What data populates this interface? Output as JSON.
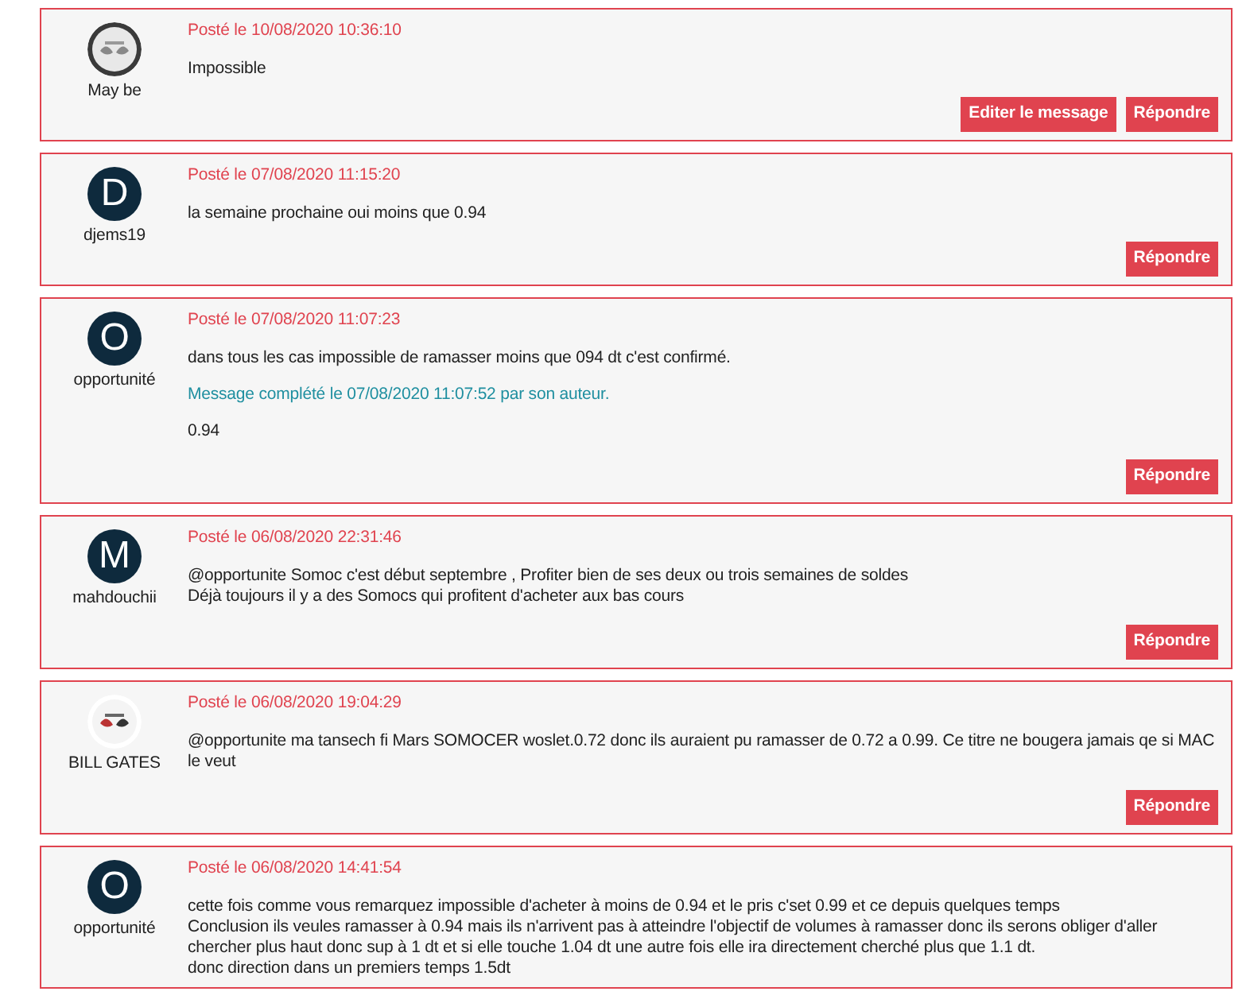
{
  "posts": [
    {
      "author": "May be",
      "avatar": {
        "kind": "picture"
      },
      "date": "Posté le 10/08/2020 10:36:10",
      "body": [
        {
          "kind": "text",
          "lines": [
            "Impossible"
          ]
        }
      ],
      "buttons": [
        "Editer le message",
        "Répondre"
      ]
    },
    {
      "author": "djems19",
      "avatar": {
        "kind": "letter",
        "initial": "D"
      },
      "date": "Posté le 07/08/2020 11:15:20",
      "body": [
        {
          "kind": "text",
          "lines": [
            "la semaine prochaine oui moins que 0.94"
          ]
        }
      ],
      "buttons": [
        "Répondre"
      ]
    },
    {
      "author": "opportunité",
      "avatar": {
        "kind": "letter",
        "initial": "O"
      },
      "date": "Posté le 07/08/2020 11:07:23",
      "body": [
        {
          "kind": "text",
          "lines": [
            "dans tous les cas impossible de ramasser moins que 094 dt c'est confirmé."
          ]
        },
        {
          "kind": "edit_note",
          "lines": [
            "Message complété le 07/08/2020 11:07:52 par son auteur."
          ]
        },
        {
          "kind": "text",
          "lines": [
            "0.94"
          ]
        }
      ],
      "buttons": [
        "Répondre"
      ]
    },
    {
      "author": "mahdouchii",
      "avatar": {
        "kind": "letter",
        "initial": "M"
      },
      "date": "Posté le 06/08/2020 22:31:46",
      "body": [
        {
          "kind": "text",
          "lines": [
            "@opportunite Somoc c'est début septembre , Profiter bien de ses deux ou trois semaines de soldes",
            "Déjà toujours il y a des Somocs qui profitent d'acheter aux bas cours"
          ]
        }
      ],
      "buttons": [
        "Répondre"
      ]
    },
    {
      "author": "BILL GATES",
      "avatar": {
        "kind": "picture"
      },
      "date": "Posté le 06/08/2020 19:04:29",
      "body": [
        {
          "kind": "text",
          "lines": [
            "@opportunite ma tansech fi Mars SOMOCER woslet.0.72 donc ils auraient pu ramasser de 0.72 a 0.99. Ce titre ne bougera jamais qe si MAC le veut"
          ]
        }
      ],
      "buttons": [
        "Répondre"
      ]
    },
    {
      "author": "opportunité",
      "avatar": {
        "kind": "letter",
        "initial": "O"
      },
      "date": "Posté le 06/08/2020 14:41:54",
      "body": [
        {
          "kind": "text",
          "lines": [
            "cette fois comme vous remarquez impossible d'acheter à moins de 0.94 et le pris c'set 0.99 et ce depuis quelques temps",
            "Conclusion ils veules ramasser à 0.94 mais ils n'arrivent pas à atteindre l'objectif de volumes à ramasser donc ils serons obliger d'aller chercher plus haut donc sup à 1 dt et si elle touche 1.04 dt une autre fois elle ira directement cherché plus que 1.1 dt.",
            "donc direction dans un premiers temps 1.5dt"
          ]
        }
      ]
    }
  ]
}
